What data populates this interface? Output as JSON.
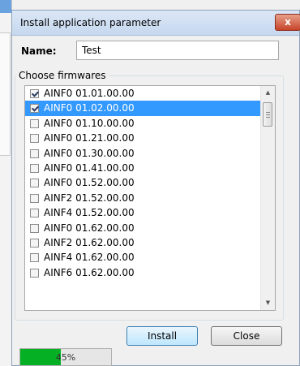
{
  "dialog": {
    "title": "Install application parameter",
    "close_glyph": "x",
    "name_label": "Name:",
    "name_value": "Test",
    "group_label": "Choose firmwares"
  },
  "firmwares": [
    {
      "label": "AINF0 01.01.00.00",
      "checked": true,
      "selected": false
    },
    {
      "label": "AINF0 01.02.00.00",
      "checked": true,
      "selected": true
    },
    {
      "label": "AINF0 01.10.00.00",
      "checked": false,
      "selected": false
    },
    {
      "label": "AINF0 01.21.00.00",
      "checked": false,
      "selected": false
    },
    {
      "label": "AINF0 01.30.00.00",
      "checked": false,
      "selected": false
    },
    {
      "label": "AINF0 01.41.00.00",
      "checked": false,
      "selected": false
    },
    {
      "label": "AINF0 01.52.00.00",
      "checked": false,
      "selected": false
    },
    {
      "label": "AINF2 01.52.00.00",
      "checked": false,
      "selected": false
    },
    {
      "label": "AINF4 01.52.00.00",
      "checked": false,
      "selected": false
    },
    {
      "label": "AINF0 01.62.00.00",
      "checked": false,
      "selected": false
    },
    {
      "label": "AINF2 01.62.00.00",
      "checked": false,
      "selected": false
    },
    {
      "label": "AINF4 01.62.00.00",
      "checked": false,
      "selected": false
    },
    {
      "label": "AINF6 01.62.00.00",
      "checked": false,
      "selected": false
    }
  ],
  "buttons": {
    "install_label": "Install",
    "close_label": "Close"
  },
  "progress": {
    "percent": 45,
    "text": "45%"
  },
  "colors": {
    "selection": "#3399ff",
    "progress_fill": "#06b025",
    "close_button": "#c7442a"
  }
}
